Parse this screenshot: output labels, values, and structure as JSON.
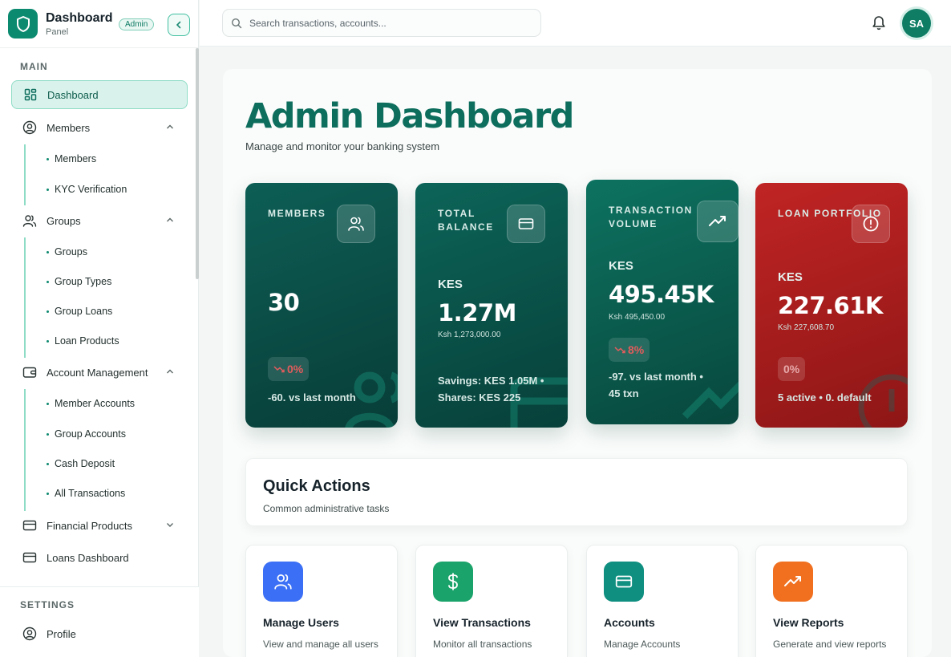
{
  "brand": {
    "title": "Dashboard",
    "subtitle": "Panel",
    "badge": "Admin"
  },
  "sidebar": {
    "main_label": "MAIN",
    "settings_label": "SETTINGS",
    "items": {
      "dashboard": "Dashboard",
      "members": "Members",
      "groups": "Groups",
      "account_management": "Account Management",
      "financial_products": "Financial Products",
      "loans_dashboard": "Loans Dashboard",
      "profile": "Profile"
    },
    "members_sub": [
      "Members",
      "KYC Verification"
    ],
    "groups_sub": [
      "Groups",
      "Group Types",
      "Group Loans",
      "Loan Products"
    ],
    "account_sub": [
      "Member Accounts",
      "Group Accounts",
      "Cash Deposit",
      "All Transactions"
    ]
  },
  "search": {
    "placeholder": "Search transactions, accounts..."
  },
  "user": {
    "initials": "SA"
  },
  "page": {
    "title": "Admin Dashboard",
    "subtitle": "Manage and monitor your banking system"
  },
  "cards": {
    "members": {
      "label": "MEMBERS",
      "value": "30",
      "change": "0%",
      "footer": "-60. vs last month"
    },
    "balance": {
      "label": "TOTAL BALANCE",
      "currency": "KES",
      "value": "1.27M",
      "exact": "Ksh 1,273,000.00",
      "footer": "Savings: KES 1.05M • Shares: KES 225"
    },
    "volume": {
      "label": "TRANSACTION VOLUME",
      "currency": "KES",
      "value": "495.45K",
      "exact": "Ksh 495,450.00",
      "change": "8%",
      "footer": "-97. vs last month • 45 txn"
    },
    "loans": {
      "label": "LOAN PORTFOLIO",
      "currency": "KES",
      "value": "227.61K",
      "exact": "Ksh 227,608.70",
      "change": "0%",
      "footer": "5 active • 0. default"
    }
  },
  "quick_actions": {
    "title": "Quick Actions",
    "subtitle": "Common administrative tasks",
    "items": [
      {
        "title": "Manage Users",
        "sub": "View and manage all users",
        "color": "#3b6ff5"
      },
      {
        "title": "View Transactions",
        "sub": "Monitor all transactions",
        "color": "#1aa36a"
      },
      {
        "title": "Accounts",
        "sub": "Manage Accounts",
        "color": "#0f8f80"
      },
      {
        "title": "View Reports",
        "sub": "Generate and view reports",
        "color": "#f07020"
      }
    ]
  },
  "colors": {
    "accent": "#0e7d64",
    "danger": "#b81e1e"
  }
}
